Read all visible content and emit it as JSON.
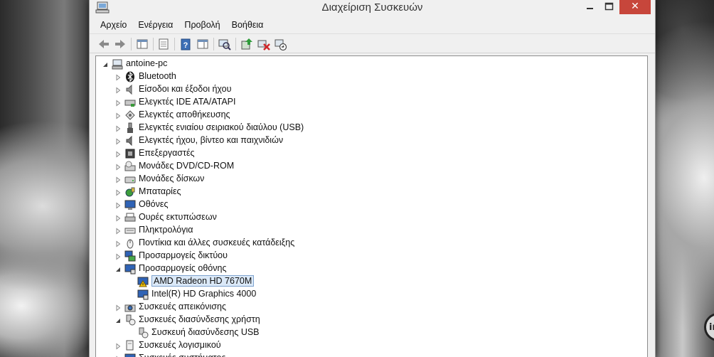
{
  "window": {
    "title": "Διαχείριση Συσκευών",
    "close_glyph": "✕",
    "icons": {
      "app": "device-manager-icon",
      "minimize": "minimize-icon",
      "maximize": "maximize-icon",
      "close": "close-icon"
    }
  },
  "menu": [
    "Αρχείο",
    "Ενέργεια",
    "Προβολή",
    "Βοήθεια"
  ],
  "toolbar": [
    {
      "name": "back-icon"
    },
    {
      "name": "forward-icon"
    },
    {
      "name": "show-hide-console-tree-icon"
    },
    {
      "name": "properties-icon"
    },
    {
      "name": "help-icon"
    },
    {
      "name": "action-pane-icon"
    },
    {
      "name": "scan-hardware-icon"
    },
    {
      "name": "update-driver-icon"
    },
    {
      "name": "uninstall-icon"
    },
    {
      "name": "disable-device-icon"
    }
  ],
  "tree": {
    "root": "antoine-pc",
    "categories": [
      {
        "label": "Bluetooth",
        "icon": "bluetooth-icon",
        "expanded": false
      },
      {
        "label": "Είσοδοι και έξοδοι ήχου",
        "icon": "speaker-icon",
        "expanded": false
      },
      {
        "label": "Ελεγκτές IDE ATA/ATAPI",
        "icon": "ide-controller-icon",
        "expanded": false
      },
      {
        "label": "Ελεγκτές αποθήκευσης",
        "icon": "storage-controller-icon",
        "expanded": false
      },
      {
        "label": "Ελεγκτές ενιαίου σειριακού διαύλου (USB)",
        "icon": "usb-icon",
        "expanded": false
      },
      {
        "label": "Ελεγκτές ήχου, βίντεο και παιχνιδιών",
        "icon": "sound-icon",
        "expanded": false
      },
      {
        "label": "Επεξεργαστές",
        "icon": "processor-icon",
        "expanded": false
      },
      {
        "label": "Μονάδες DVD/CD-ROM",
        "icon": "dvd-drive-icon",
        "expanded": false
      },
      {
        "label": "Μονάδες δίσκων",
        "icon": "disk-drive-icon",
        "expanded": false
      },
      {
        "label": "Μπαταρίες",
        "icon": "battery-icon",
        "expanded": false
      },
      {
        "label": "Οθόνες",
        "icon": "monitor-icon",
        "expanded": false
      },
      {
        "label": "Ουρές εκτυπώσεων",
        "icon": "print-queue-icon",
        "expanded": false
      },
      {
        "label": "Πληκτρολόγια",
        "icon": "keyboard-icon",
        "expanded": false
      },
      {
        "label": "Ποντίκια και άλλες συσκευές κατάδειξης",
        "icon": "mouse-icon",
        "expanded": false
      },
      {
        "label": "Προσαρμογείς δικτύου",
        "icon": "network-adapter-icon",
        "expanded": false
      },
      {
        "label": "Προσαρμογείς οθόνης",
        "icon": "display-adapter-icon",
        "expanded": true,
        "children": [
          {
            "label": "AMD Radeon HD 7670M",
            "icon": "display-adapter-warning-icon",
            "selected": true
          },
          {
            "label": "Intel(R) HD Graphics 4000",
            "icon": "display-adapter-icon",
            "selected": false
          }
        ]
      },
      {
        "label": "Συσκευές απεικόνισης",
        "icon": "camera-icon",
        "expanded": false
      },
      {
        "label": "Συσκευές διασύνδεσης χρήστη",
        "icon": "hid-icon",
        "expanded": true,
        "children": [
          {
            "label": "Συσκευή διασύνδεσης USB",
            "icon": "hid-icon",
            "selected": false
          }
        ]
      },
      {
        "label": "Συσκευές λογισμικού",
        "icon": "software-device-icon",
        "expanded": false
      },
      {
        "label": "Συσκευές συστήματος",
        "icon": "system-device-icon",
        "expanded": false
      }
    ]
  },
  "colors": {
    "accent_close": "#c7463b",
    "selection_bg": "#dbe9f8",
    "selection_border": "#7da2ce",
    "warning": "#f2c200"
  }
}
